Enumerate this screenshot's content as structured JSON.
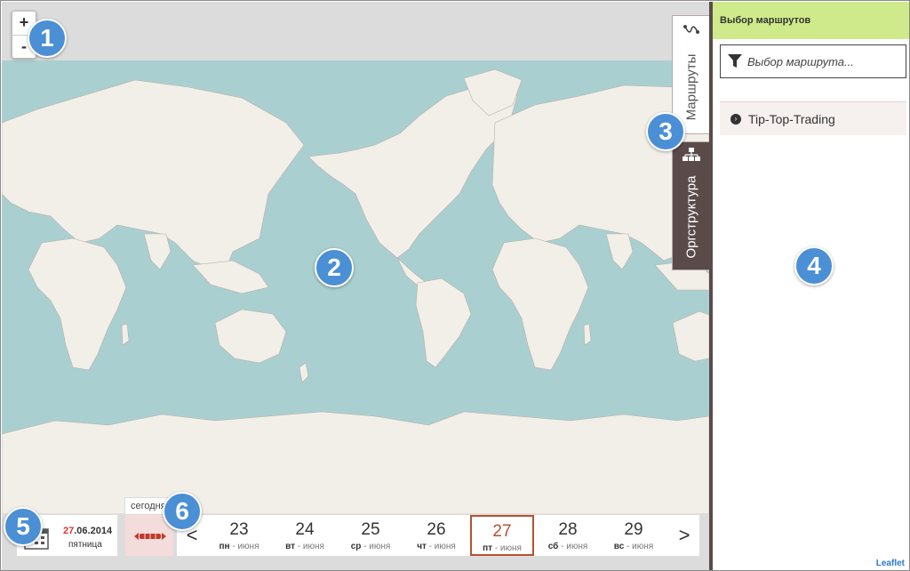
{
  "map": {
    "zoom_in": "+",
    "zoom_out": "-",
    "attribution": "Leaflet"
  },
  "tabs": {
    "routes": "Маршруты",
    "org": "Оргструктура"
  },
  "panel": {
    "title": "Выбор маршрутов",
    "search_placeholder": "Выбор маршрута...",
    "routes": [
      "Tip-Top-Trading"
    ]
  },
  "date_bar": {
    "current_day": "27",
    "current_rest": ".06.2014",
    "weekday": "пятница",
    "today_label": "сегодня",
    "prev": "<",
    "next": ">",
    "days": [
      {
        "num": "23",
        "dow": "пн",
        "month": "июня"
      },
      {
        "num": "24",
        "dow": "вт",
        "month": "июня"
      },
      {
        "num": "25",
        "dow": "ср",
        "month": "июня"
      },
      {
        "num": "26",
        "dow": "чт",
        "month": "июня"
      },
      {
        "num": "27",
        "dow": "пт",
        "month": "июня",
        "selected": true
      },
      {
        "num": "28",
        "dow": "сб",
        "month": "июня"
      },
      {
        "num": "29",
        "dow": "вс",
        "month": "июня"
      }
    ]
  },
  "callouts": [
    "1",
    "2",
    "3",
    "4",
    "5",
    "6"
  ],
  "colors": {
    "ocean": "#aacfd0",
    "land": "#f2efe9",
    "panel_header": "#cfea8a",
    "tab_dark": "#5a4a4a",
    "callout": "#4b8fd5",
    "selected_day": "#b5522f",
    "date_red": "#d9362b"
  }
}
